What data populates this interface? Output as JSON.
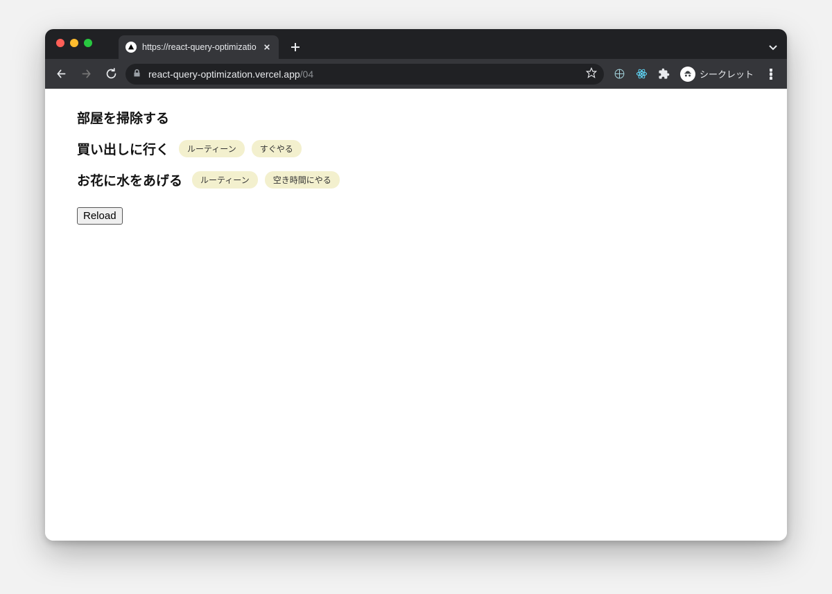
{
  "browser": {
    "tab": {
      "title": "https://react-query-optimizatio"
    },
    "url_host_path": "react-query-optimization.vercel.app",
    "url_suffix": "/04",
    "incognito_label": "シークレット"
  },
  "page": {
    "todos": [
      {
        "title": "部屋を掃除する",
        "tags": []
      },
      {
        "title": "買い出しに行く",
        "tags": [
          "ルーティーン",
          "すぐやる"
        ]
      },
      {
        "title": "お花に水をあげる",
        "tags": [
          "ルーティーン",
          "空き時間にやる"
        ]
      }
    ],
    "reload_label": "Reload"
  }
}
